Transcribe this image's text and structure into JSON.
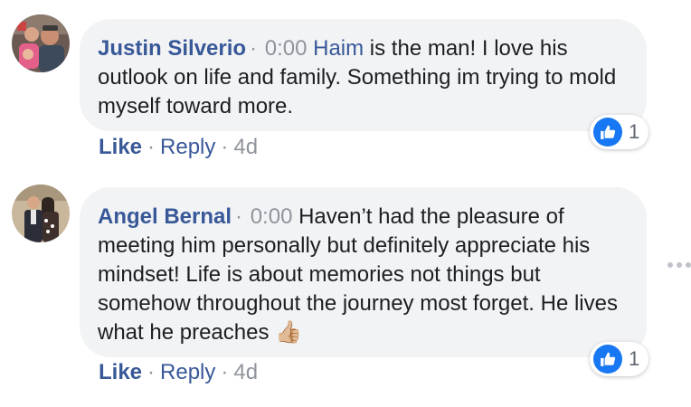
{
  "comments": [
    {
      "author": "Justin Silverio",
      "separator": "·",
      "time": "0:00",
      "mention": "Haim",
      "text": " is the man! I love his outlook on life and family. Something im trying to mold myself toward more.",
      "reaction_count": "1",
      "actions": {
        "like": "Like",
        "reply": "Reply",
        "age": "4d",
        "dot": "·"
      }
    },
    {
      "author": "Angel Bernal",
      "separator": "·",
      "time": "0:00",
      "text": "Haven’t had the pleasure of meeting him personally but definitely appreciate his mindset! Life is about memories not things but somehow throughout the journey most forget. He lives what he preaches",
      "emoji": "👍🏼",
      "reaction_count": "1",
      "actions": {
        "like": "Like",
        "reply": "Reply",
        "age": "4d",
        "dot": "·"
      }
    }
  ],
  "icons": {
    "reaction": "thumbs-up-icon",
    "more": "more-options-icon",
    "like_color": "#1877f2",
    "author_color": "#385898"
  }
}
